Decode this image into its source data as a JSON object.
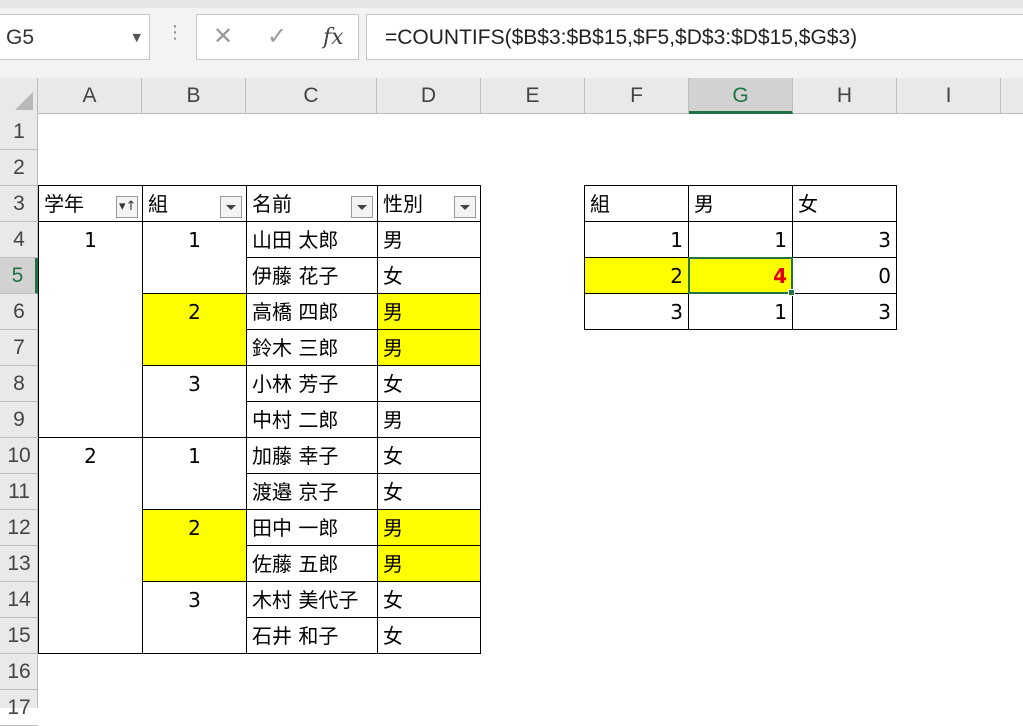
{
  "name_box": "G5",
  "formula": "=COUNTIFS($B$3:$B$15,$F5,$D$3:$D$15,$G$3)",
  "formula_buttons": {
    "cancel": "✕",
    "enter": "✓",
    "fx": "fx"
  },
  "columns": [
    "A",
    "B",
    "C",
    "D",
    "E",
    "F",
    "G",
    "H",
    "I"
  ],
  "active_column": "G",
  "rows": [
    "1",
    "2",
    "3",
    "4",
    "5",
    "6",
    "7",
    "8",
    "9",
    "10",
    "11",
    "12",
    "13",
    "14",
    "15",
    "16",
    "17"
  ],
  "active_row": "5",
  "table1": {
    "headers": [
      "学年",
      "組",
      "名前",
      "性別"
    ],
    "grade": [
      "1",
      "2"
    ],
    "class": [
      "1",
      "2",
      "3",
      "1",
      "2",
      "3"
    ],
    "names": [
      "山田 太郎",
      "伊藤 花子",
      "高橋 四郎",
      "鈴木 三郎",
      "小林 芳子",
      "中村 二郎",
      "加藤 幸子",
      "渡邉 京子",
      "田中 一郎",
      "佐藤 五郎",
      "木村 美代子",
      "石井 和子"
    ],
    "genders": [
      "男",
      "女",
      "男",
      "男",
      "女",
      "男",
      "女",
      "女",
      "男",
      "男",
      "女",
      "女"
    ]
  },
  "table2": {
    "headers": [
      "組",
      "男",
      "女"
    ],
    "rows": [
      [
        "1",
        "1",
        "3"
      ],
      [
        "2",
        "4",
        "0"
      ],
      [
        "3",
        "1",
        "3"
      ]
    ]
  },
  "colors": {
    "highlight": "#ffff00",
    "accent": "#217346",
    "result": "#e00000"
  }
}
